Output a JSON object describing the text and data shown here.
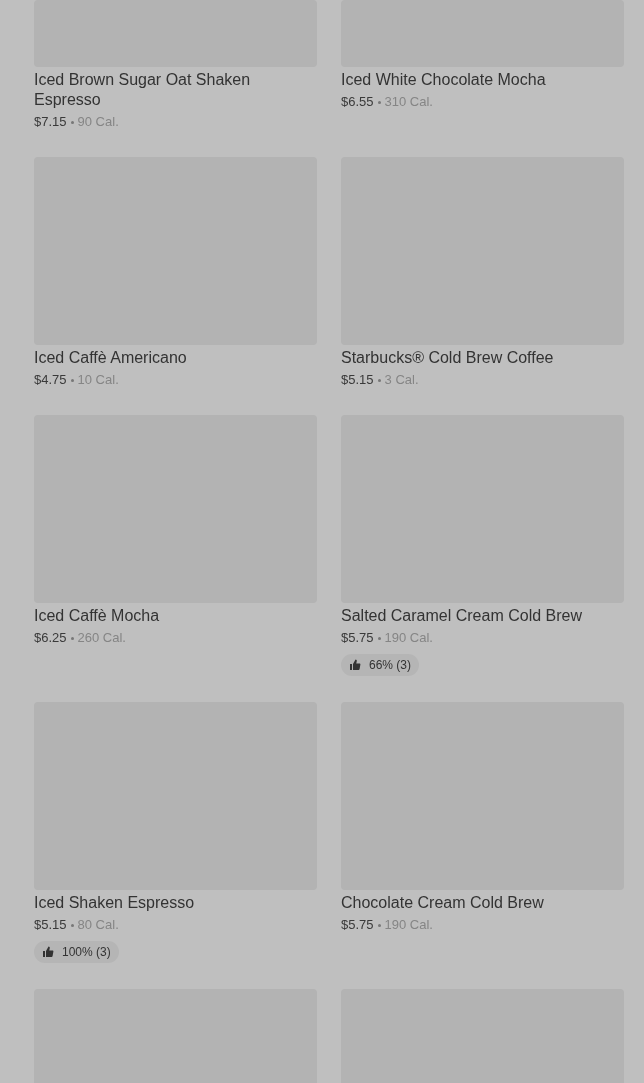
{
  "items": [
    {
      "name": "Iced Brown Sugar Oat Shaken Espresso",
      "price": "$7.15",
      "calories": "90 Cal."
    },
    {
      "name": "Iced White Chocolate Mocha",
      "price": "$6.55",
      "calories": "310 Cal."
    },
    {
      "name": "Iced Caffè Americano",
      "price": "$4.75",
      "calories": "10 Cal."
    },
    {
      "name": "Starbucks® Cold Brew Coffee",
      "price": "$5.15",
      "calories": "3 Cal."
    },
    {
      "name": "Iced Caffè Mocha",
      "price": "$6.25",
      "calories": "260 Cal."
    },
    {
      "name": "Salted Caramel Cream Cold Brew",
      "price": "$5.75",
      "calories": "190 Cal.",
      "rating": "66% (3)"
    },
    {
      "name": "Iced Shaken Espresso",
      "price": "$5.15",
      "calories": "80 Cal.",
      "rating": "100% (3)"
    },
    {
      "name": "Chocolate Cream Cold Brew",
      "price": "$5.75",
      "calories": "190 Cal."
    }
  ],
  "more_cards": [
    {
      "kind": "image"
    },
    {
      "kind": "image"
    }
  ]
}
